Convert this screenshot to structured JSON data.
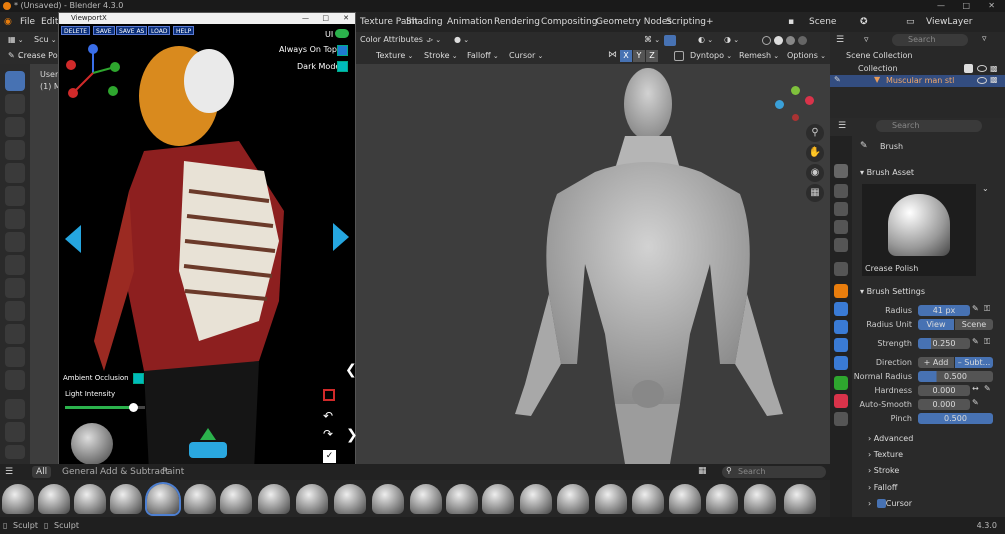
{
  "window": {
    "title": "* (Unsaved) - Blender 4.3.0"
  },
  "menu": {
    "file": "File",
    "edit": "Edit",
    "workspace_tabs": [
      "Texture Paint",
      "Shading",
      "Animation",
      "Rendering",
      "Compositing",
      "Geometry Nodes",
      "Scripting"
    ],
    "add_tab": "+",
    "scene": "Scene",
    "view_layer": "ViewLayer"
  },
  "header": {
    "mode": "Scu",
    "tool_name": "Crease Polish",
    "color_attributes": "Color Attributes",
    "texture": "Texture",
    "stroke": "Stroke",
    "falloff": "Falloff",
    "cursor": "Cursor",
    "axis_x": "X",
    "axis_y": "Y",
    "axis_z": "Z",
    "dyntopo": "Dyntopo",
    "remesh": "Remesh",
    "options": "Options"
  },
  "viewport": {
    "view_label_1": "User",
    "view_label_2": "(1) M",
    "search_placeholder": "Search"
  },
  "overlay": {
    "title": "ViewportX",
    "buttons": [
      "DELETE",
      "SAVE",
      "SAVE AS",
      "LOAD",
      "HELP"
    ],
    "ui_label": "UI",
    "always_on_top": "Always On Top",
    "dark_mode": "Dark Mode",
    "ambient_occlusion": "Ambient Occlusion",
    "light_intensity": "Light Intensity",
    "light_intensity_level": 0.85
  },
  "assetshelf": {
    "tabs": [
      "All",
      "General",
      "Add & Subtract",
      "Paint"
    ],
    "search_placeholder": "Search"
  },
  "outliner": {
    "search_placeholder": "Search",
    "scene_collection": "Scene Collection",
    "collection": "Collection",
    "object": "Muscular man stl"
  },
  "properties": {
    "search_placeholder": "Search",
    "brush_title": "Brush",
    "brush_asset_section": "Brush Asset",
    "brush_asset_name": "Crease Polish",
    "brush_settings_section": "Brush Settings",
    "radius_label": "Radius",
    "radius_value": "41 px",
    "radius_unit_label": "Radius Unit",
    "radius_unit_view": "View",
    "radius_unit_scene": "Scene",
    "strength_label": "Strength",
    "strength_value": "0.250",
    "direction_label": "Direction",
    "direction_add": "Add",
    "direction_subtract": "Subt...",
    "normal_radius_label": "Normal Radius",
    "normal_radius_value": "0.500",
    "hardness_label": "Hardness",
    "hardness_value": "0.000",
    "auto_smooth_label": "Auto-Smooth",
    "auto_smooth_value": "0.000",
    "pinch_label": "Pinch",
    "pinch_value": "0.500",
    "panels": [
      "Advanced",
      "Texture",
      "Stroke",
      "Falloff",
      "Cursor"
    ]
  },
  "status": {
    "left_1": "Sculpt",
    "left_2": "Sculpt",
    "version": "4.3.0"
  },
  "colors": {
    "accent": "#4772b3",
    "background": "#1d1d1d",
    "panel": "#2a2a2a",
    "overlay_button": "#0b2f7a",
    "arrow": "#25a6e0",
    "checkbox": "#0bb"
  }
}
